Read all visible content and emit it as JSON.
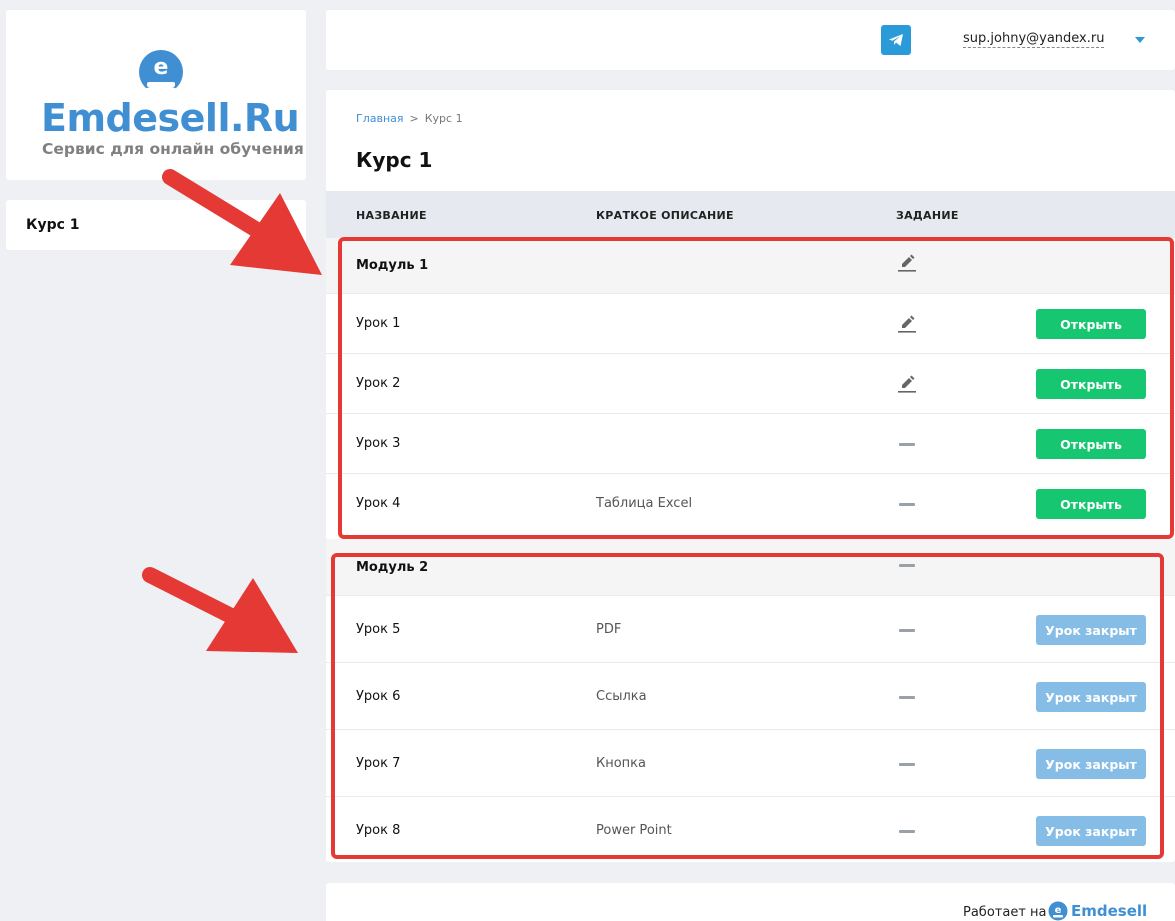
{
  "logo": {
    "name": "Emdesell",
    "tld": ".Ru",
    "tagline": "Сервис для онлайн обучения"
  },
  "sidebar": {
    "items": [
      {
        "label": "Курс 1"
      }
    ]
  },
  "header": {
    "user_email": "sup.johny@yandex.ru"
  },
  "breadcrumb": {
    "home": "Главная",
    "separator": ">",
    "current": "Курс 1"
  },
  "page_title": "Курс 1",
  "table": {
    "columns": {
      "name": "НАЗВАНИЕ",
      "desc": "КРАТКОЕ ОПИСАНИЕ",
      "task": "ЗАДАНИЕ"
    },
    "modules": [
      {
        "name": "Модуль 1",
        "task": "edit-icon",
        "lessons": [
          {
            "name": "Урок 1",
            "desc": "",
            "task": "edit-icon",
            "action": "Открыть",
            "status": "open"
          },
          {
            "name": "Урок 2",
            "desc": "",
            "task": "edit-icon",
            "action": "Открыть",
            "status": "open"
          },
          {
            "name": "Урок 3",
            "desc": "",
            "task": "dash-icon",
            "action": "Открыть",
            "status": "open"
          },
          {
            "name": "Урок 4",
            "desc": "Таблица Excel",
            "task": "dash-icon",
            "action": "Открыть",
            "status": "open"
          }
        ]
      },
      {
        "name": "Модуль 2",
        "task": "dash-icon",
        "lessons": [
          {
            "name": "Урок 5",
            "desc": "PDF",
            "task": "dash-icon",
            "action": "Урок закрыт",
            "status": "closed"
          },
          {
            "name": "Урок 6",
            "desc": "Ссылка",
            "task": "dash-icon",
            "action": "Урок закрыт",
            "status": "closed"
          },
          {
            "name": "Урок 7",
            "desc": "Кнопка",
            "task": "dash-icon",
            "action": "Урок закрыт",
            "status": "closed"
          },
          {
            "name": "Урок 8",
            "desc": "Power Point",
            "task": "dash-icon",
            "action": "Урок закрыт",
            "status": "closed"
          }
        ]
      }
    ]
  },
  "footer": {
    "powered_by": "Работает на",
    "brand": "Emdesell"
  },
  "colors": {
    "brand_blue": "#3f8fd2",
    "open_green": "#17c670",
    "closed_blue": "#86bde6",
    "annotation_red": "#e53935"
  }
}
